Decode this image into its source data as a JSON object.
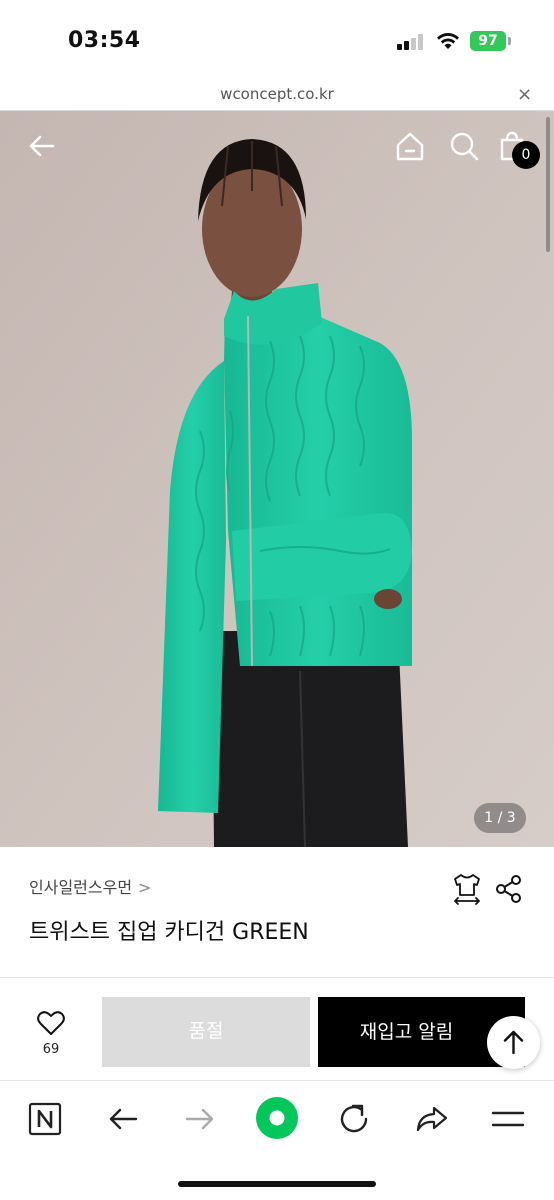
{
  "status_bar": {
    "time": "03:54",
    "battery": "97"
  },
  "browser": {
    "url": "wconcept.co.kr",
    "close_symbol": "×"
  },
  "hero": {
    "page_indicator": "1 / 3",
    "cart_count": "0"
  },
  "product": {
    "brand": "인사일런스우먼",
    "brand_chevron": ">",
    "title": "트위스트 집업 카디건 GREEN"
  },
  "actions": {
    "like_count": "69",
    "soldout_label": "품절",
    "restock_label": "재입고 알림"
  },
  "icons": {
    "back": "arrow-left-icon",
    "home": "home-icon",
    "search": "search-icon",
    "cart": "shopping-bag-icon",
    "size": "size-guide-icon",
    "share": "share-icon",
    "like": "heart-icon",
    "scroll_top": "arrow-up-icon",
    "naver": "naver-n-icon",
    "browser_back": "arrow-left-icon",
    "browser_forward": "arrow-right-icon",
    "green_dot": "green-circle-icon",
    "reload": "reload-icon",
    "browser_share": "share-forward-icon",
    "menu": "menu-icon"
  },
  "colors": {
    "sweater": "#1fc7a0",
    "brand_green": "#03c75a",
    "battery": "#34c759",
    "soldout": "#dcdcdc",
    "restock": "#000000"
  }
}
